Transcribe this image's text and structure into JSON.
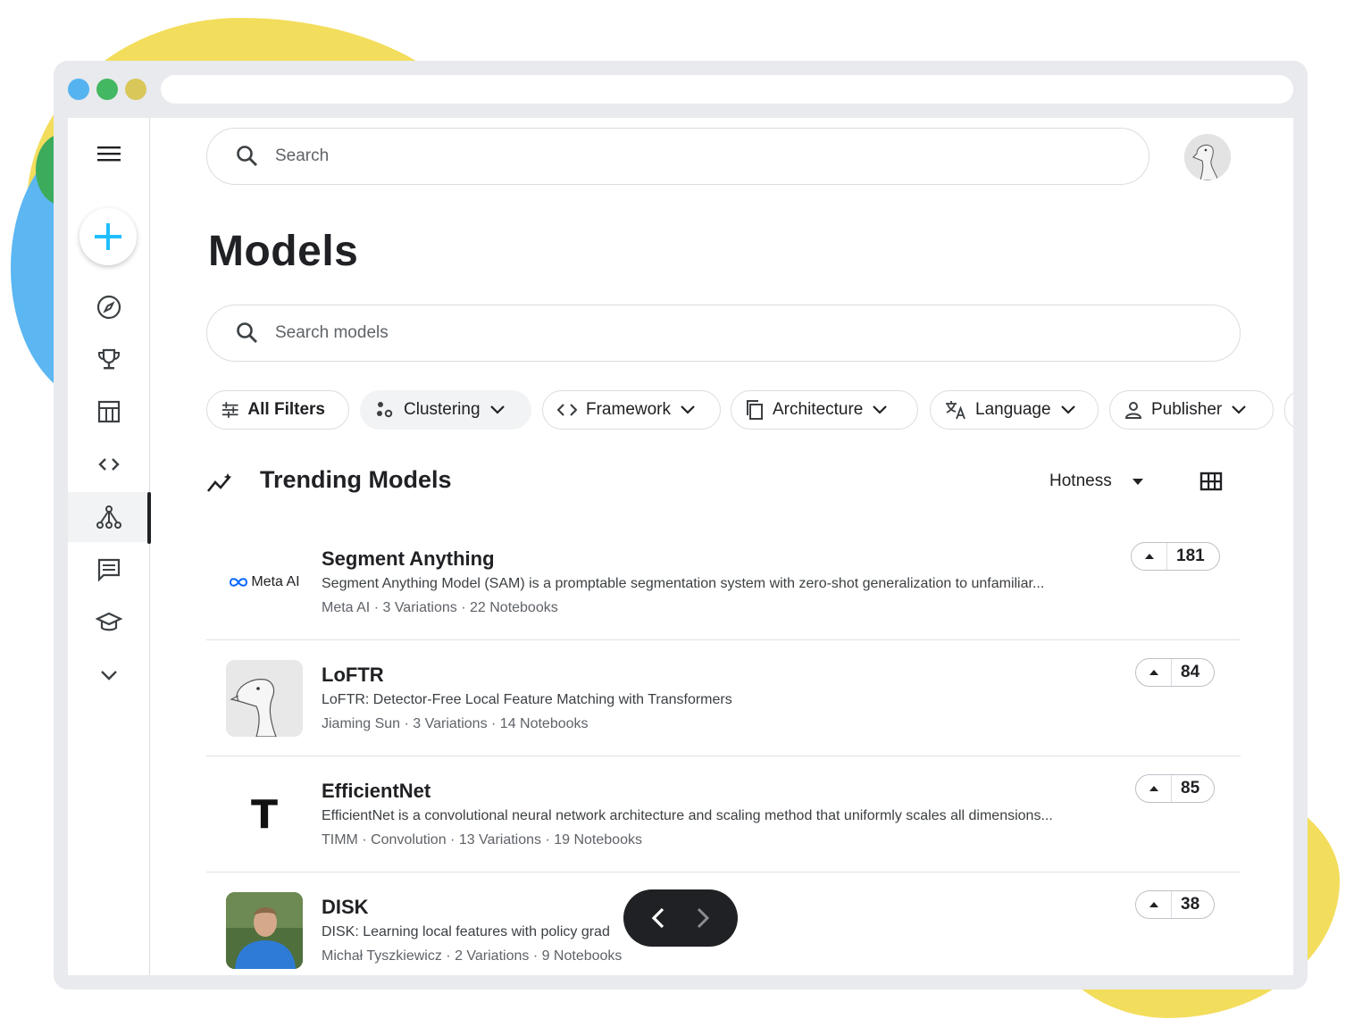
{
  "search": {
    "placeholder": "Search"
  },
  "page": {
    "title": "Models"
  },
  "model_search": {
    "placeholder": "Search models"
  },
  "filters": [
    {
      "label": "All Filters",
      "icon": "sliders-icon"
    },
    {
      "label": "Clustering",
      "icon": "clustering-icon"
    },
    {
      "label": "Framework",
      "icon": "code-icon"
    },
    {
      "label": "Architecture",
      "icon": "copy-icon"
    },
    {
      "label": "Language",
      "icon": "translate-icon"
    },
    {
      "label": "Publisher",
      "icon": "person-icon"
    }
  ],
  "section": {
    "title": "Trending Models",
    "sort_label": "Hotness"
  },
  "sidebar": {
    "items": [
      {
        "name": "menu-icon"
      },
      {
        "name": "create-icon"
      },
      {
        "name": "explore-icon"
      },
      {
        "name": "competitions-icon"
      },
      {
        "name": "datasets-icon"
      },
      {
        "name": "code-icon"
      },
      {
        "name": "models-icon",
        "active": true
      },
      {
        "name": "discussions-icon"
      },
      {
        "name": "learn-icon"
      },
      {
        "name": "more-chevron-icon"
      }
    ]
  },
  "models": [
    {
      "name": "Segment Anything",
      "logo_text": "Meta AI",
      "description": "Segment Anything Model (SAM) is a promptable segmentation system with zero-shot generalization to unfamiliar...",
      "meta": "Meta AI · 3 Variations · 22 Notebooks",
      "votes": "181"
    },
    {
      "name": "LoFTR",
      "description": "LoFTR: Detector-Free Local Feature Matching with Transformers",
      "meta": "Jiaming Sun · 3 Variations · 14 Notebooks",
      "votes": "84"
    },
    {
      "name": "EfficientNet",
      "logo_text": "T",
      "description": "EfficientNet is a convolutional neural network architecture and scaling method that uniformly scales all dimensions...",
      "meta": "TIMM · Convolution · 13 Variations · 19 Notebooks",
      "votes": "85"
    },
    {
      "name": "DISK",
      "description": "DISK: Learning local features with policy grad",
      "meta": "Michał Tyszkiewicz · 2 Variations · 9 Notebooks",
      "votes": "38"
    }
  ],
  "colors": {
    "accent": "#20beff",
    "text": "#202124",
    "muted": "#5f6368",
    "border": "#dadce0"
  }
}
